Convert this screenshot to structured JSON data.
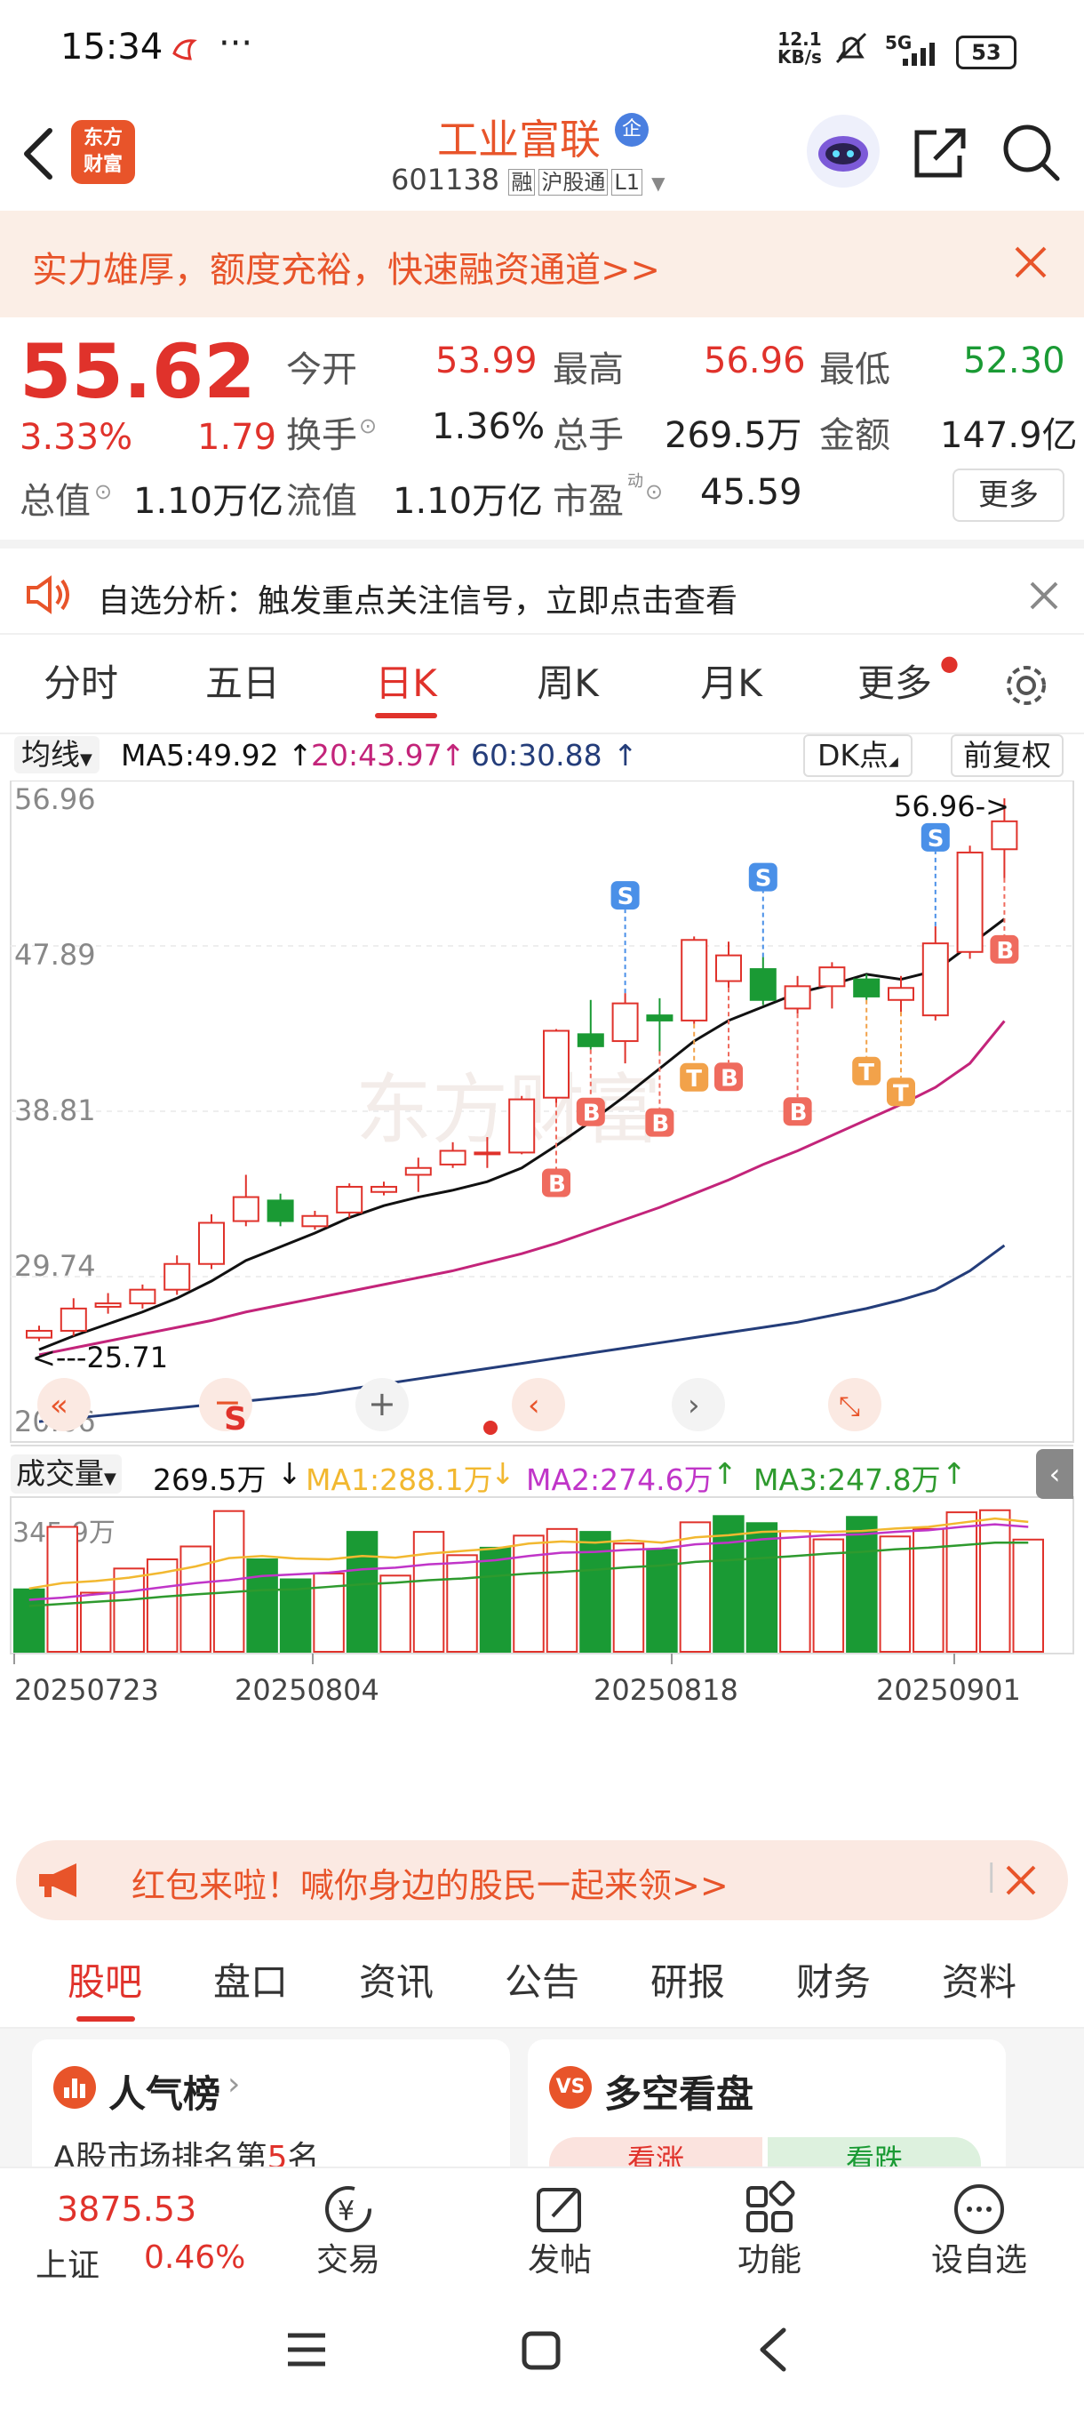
{
  "status": {
    "time": "15:34",
    "net_speed_top": "12.1",
    "net_speed_bottom": "KB/s",
    "network": "5G",
    "battery": "53"
  },
  "nav": {
    "logo_line1": "东方",
    "logo_line2": "财富",
    "stock_name": "工业富联",
    "stock_badge": "企",
    "code": "601138",
    "tag1": "融",
    "tag2": "沪股通",
    "tag3": "L1"
  },
  "banner": {
    "text": "实力雄厚，额度充裕，快速融资通道>>"
  },
  "quote": {
    "price": "55.62",
    "change_pct": "3.33%",
    "change": "1.79",
    "open_label": "今开",
    "open": "53.99",
    "high_label": "最高",
    "high": "56.96",
    "low_label": "最低",
    "low": "52.30",
    "turnover_label": "换手",
    "turnover": "1.36%",
    "volume_label": "总手",
    "volume": "269.5万",
    "amount_label": "金额",
    "amount": "147.9亿",
    "mktcap_label": "总值",
    "mktcap": "1.10万亿",
    "float_label": "流值",
    "float": "1.10万亿",
    "pe_label": "市盈",
    "pe_sup": "动",
    "pe": "45.59",
    "more_label": "更多"
  },
  "notice": {
    "text": "自选分析：触发重点关注信号，立即点击查看"
  },
  "tabs": {
    "t1": "分时",
    "t2": "五日",
    "t3": "日K",
    "t4": "周K",
    "t5": "月K",
    "t6": "更多"
  },
  "ma": {
    "selector": "均线",
    "ma5": "MA5:49.92",
    "ma20": "20:43.97",
    "ma60": "60:30.88",
    "dk": "DK点",
    "adjust": "前复权"
  },
  "volume_panel": {
    "selector": "成交量",
    "value": "269.5万",
    "ma1": "MA1:288.1万",
    "ma2": "MA2:274.6万",
    "ma3": "MA3:247.8万"
  },
  "chart_data": [
    {
      "type": "candlestick",
      "y_ticks": [
        "56.96",
        "47.89",
        "38.81",
        "29.74",
        "20.66"
      ],
      "ylim": [
        20.66,
        56.96
      ],
      "x_ticks": [
        "20250723",
        "20250804",
        "20250818",
        "20250901"
      ],
      "annotations": {
        "max": "56.96->",
        "min": "<---25.71"
      },
      "signals": {
        "b": "B",
        "s": "S",
        "t": "T"
      },
      "candles": [
        {
          "o": 25.5,
          "c": 25.9,
          "h": 26.2,
          "l": 25.3
        },
        {
          "o": 25.9,
          "c": 27.2,
          "h": 27.8,
          "l": 25.6
        },
        {
          "o": 27.3,
          "c": 27.5,
          "h": 28.1,
          "l": 26.9
        },
        {
          "o": 27.5,
          "c": 28.3,
          "h": 28.6,
          "l": 27.2
        },
        {
          "o": 28.3,
          "c": 29.8,
          "h": 30.3,
          "l": 28.0
        },
        {
          "o": 29.8,
          "c": 32.2,
          "h": 32.7,
          "l": 29.5
        },
        {
          "o": 32.3,
          "c": 33.7,
          "h": 35.0,
          "l": 32.0
        },
        {
          "o": 33.5,
          "c": 32.3,
          "h": 33.9,
          "l": 32.0
        },
        {
          "o": 32.0,
          "c": 32.6,
          "h": 32.9,
          "l": 31.8
        },
        {
          "o": 32.8,
          "c": 34.3,
          "h": 34.5,
          "l": 32.5
        },
        {
          "o": 34.0,
          "c": 34.3,
          "h": 34.6,
          "l": 33.8
        },
        {
          "o": 35.0,
          "c": 35.4,
          "h": 36.0,
          "l": 34.0
        },
        {
          "o": 35.6,
          "c": 36.4,
          "h": 36.9,
          "l": 35.4
        },
        {
          "o": 36.2,
          "c": 36.3,
          "h": 37.2,
          "l": 35.4
        },
        {
          "o": 36.3,
          "c": 39.4,
          "h": 39.6,
          "l": 36.2
        },
        {
          "o": 39.5,
          "c": 43.4,
          "h": 43.5,
          "l": 39.2
        },
        {
          "o": 43.2,
          "c": 42.5,
          "h": 45.2,
          "l": 42.3
        },
        {
          "o": 42.8,
          "c": 45.0,
          "h": 45.6,
          "l": 41.5
        },
        {
          "o": 44.3,
          "c": 44.0,
          "h": 45.3,
          "l": 42.2
        },
        {
          "o": 44.0,
          "c": 48.7,
          "h": 48.9,
          "l": 43.8
        },
        {
          "o": 46.3,
          "c": 47.8,
          "h": 48.6,
          "l": 45.9
        },
        {
          "o": 47.0,
          "c": 45.2,
          "h": 47.7,
          "l": 44.9
        },
        {
          "o": 44.7,
          "c": 46.0,
          "h": 46.6,
          "l": 44.4
        },
        {
          "o": 46.0,
          "c": 47.1,
          "h": 47.4,
          "l": 44.7
        },
        {
          "o": 46.4,
          "c": 45.4,
          "h": 46.7,
          "l": 45.2
        },
        {
          "o": 45.2,
          "c": 45.9,
          "h": 46.6,
          "l": 44.5
        },
        {
          "o": 44.3,
          "c": 48.5,
          "h": 49.5,
          "l": 44.0
        },
        {
          "o": 48.0,
          "c": 53.8,
          "h": 54.2,
          "l": 47.6
        },
        {
          "o": 53.99,
          "c": 55.62,
          "h": 56.96,
          "l": 52.3
        }
      ],
      "ma5": [
        24.8,
        25.6,
        26.3,
        27.0,
        27.8,
        28.8,
        30.0,
        30.8,
        31.6,
        32.5,
        33.2,
        33.7,
        34.1,
        34.6,
        35.4,
        36.7,
        38.1,
        39.6,
        41.2,
        42.8,
        44.0,
        44.8,
        45.6,
        46.1,
        46.7,
        46.4,
        46.9,
        48.4,
        49.92
      ],
      "ma20": [
        24.5,
        24.9,
        25.3,
        25.7,
        26.1,
        26.5,
        27.0,
        27.4,
        27.8,
        28.2,
        28.6,
        29.0,
        29.4,
        29.9,
        30.4,
        31.0,
        31.7,
        32.4,
        33.1,
        33.9,
        34.7,
        35.6,
        36.4,
        37.3,
        38.2,
        39.1,
        40.1,
        41.5,
        43.97
      ],
      "ma60": [
        20.6,
        20.8,
        21.0,
        21.2,
        21.4,
        21.6,
        21.8,
        22.0,
        22.2,
        22.5,
        22.8,
        23.1,
        23.4,
        23.7,
        24.0,
        24.3,
        24.6,
        24.9,
        25.2,
        25.5,
        25.8,
        26.1,
        26.4,
        26.8,
        27.2,
        27.7,
        28.3,
        29.4,
        30.88
      ]
    },
    {
      "type": "bar",
      "title": "成交量",
      "y_max_label": "345.9万",
      "ylim": [
        0,
        345.9
      ],
      "values": [
        150,
        300,
        142,
        200,
        222,
        253,
        338,
        222,
        174,
        188,
        288,
        183,
        288,
        232,
        250,
        279,
        295,
        288,
        260,
        245,
        311,
        326,
        309,
        290,
        270,
        324,
        277,
        295,
        335,
        340,
        269.5
      ],
      "colors": [
        "g",
        "r",
        "r",
        "r",
        "r",
        "r",
        "r",
        "g",
        "g",
        "r",
        "g",
        "r",
        "r",
        "r",
        "g",
        "r",
        "r",
        "g",
        "r",
        "g",
        "r",
        "g",
        "g",
        "r",
        "r",
        "g",
        "r",
        "r",
        "r",
        "r",
        "r"
      ],
      "ma1": [
        152,
        165,
        170,
        178,
        190,
        205,
        225,
        230,
        224,
        222,
        230,
        226,
        236,
        242,
        248,
        260,
        265,
        262,
        268,
        262,
        275,
        280,
        288,
        290,
        288,
        290,
        296,
        300,
        310,
        320,
        312
      ],
      "ma2": [
        125,
        130,
        138,
        145,
        155,
        165,
        172,
        182,
        186,
        190,
        198,
        202,
        210,
        214,
        220,
        230,
        238,
        240,
        245,
        248,
        258,
        262,
        270,
        275,
        280,
        282,
        288,
        292,
        300,
        306,
        300
      ],
      "ma3": [
        110,
        115,
        120,
        125,
        132,
        138,
        143,
        148,
        150,
        156,
        162,
        166,
        172,
        176,
        182,
        188,
        192,
        197,
        203,
        207,
        216,
        220,
        225,
        230,
        236,
        240,
        246,
        250,
        256,
        262,
        262
      ]
    }
  ],
  "redpkt": {
    "text": "红包来啦！喊你身边的股民一起来领>>"
  },
  "btabs": {
    "b1": "股吧",
    "b2": "盘口",
    "b3": "资讯",
    "b4": "公告",
    "b5": "研报",
    "b6": "财务",
    "b7": "资料"
  },
  "cards": {
    "c1_title": "人气榜",
    "c1_sub_pre": "A股市场排名第",
    "c1_rank": "5",
    "c1_sub_post": "名",
    "c2_title": "多空看盘",
    "c2_up": "看涨",
    "c2_down": "看跌"
  },
  "bottom": {
    "index_value": "3875.53",
    "index_name": "上证",
    "index_pct": "0.46%",
    "trade": "交易",
    "post": "发帖",
    "func": "功能",
    "watch": "设自选"
  },
  "colors": {
    "up": "#e0322b",
    "down": "#1a9a34",
    "ma5": "#111111",
    "ma20": "#c3247a",
    "ma60": "#243d7a",
    "vol_ma1": "#f2b830",
    "vol_ma2": "#c035c8",
    "vol_ma3": "#2e9a2e"
  }
}
